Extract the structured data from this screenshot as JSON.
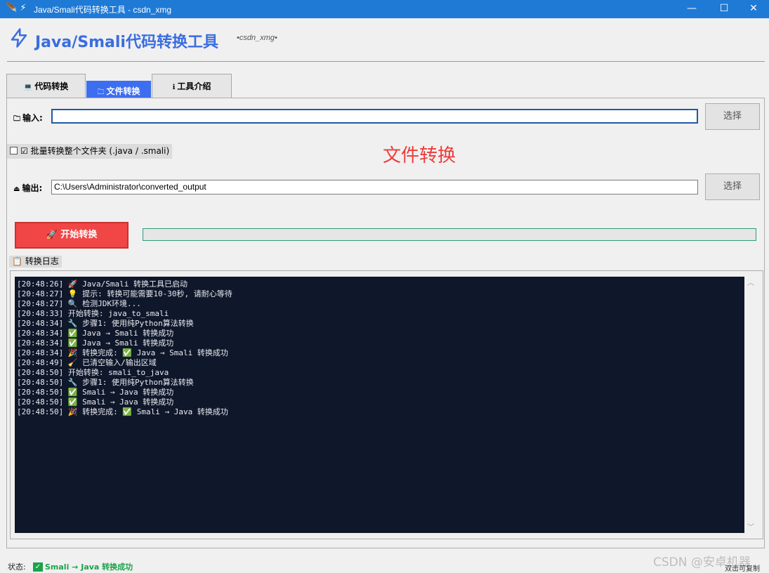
{
  "window": {
    "title": "Java/Smali代码转换工具 - csdn_xmg",
    "controls": {
      "minimize": "—",
      "maximize": "☐",
      "close": "✕"
    }
  },
  "header": {
    "title": "Java/Smali代码转换工具",
    "subtitle": "•csdn_xmg•",
    "accent_color": "#3a6de0"
  },
  "tabs": [
    {
      "label": "代码转换",
      "icon": "laptop-icon",
      "glyph": "💻"
    },
    {
      "label": "文件转换",
      "icon": "folder-icon",
      "glyph": "🗀"
    },
    {
      "label": "工具介绍",
      "icon": "info-icon",
      "glyph": "ℹ"
    }
  ],
  "form": {
    "input_label": "输入:",
    "input_value": "",
    "input_select": "选择",
    "batch_label": "☑ 批量转换整个文件夹 (.java / .smali)",
    "batch_checked": false,
    "section_title": "文件转换",
    "output_label": "输出:",
    "output_value": "C:\\Users\\Administrator\\converted_output",
    "output_select": "选择",
    "start_label": "🚀 开始转换",
    "progress": 0
  },
  "log": {
    "label": "转换日志",
    "lines": [
      "[20:48:26] 🚀 Java/Smali 转换工具已启动",
      "[20:48:27] 💡 提示: 转换可能需要10-30秒, 请耐心等待",
      "[20:48:27] 🔍 检测JDK环境...",
      "[20:48:33] 开始转换: java_to_smali",
      "[20:48:34] 🔧 步骤1: 使用纯Python算法转换",
      "[20:48:34] ✅ Java → Smali 转换成功",
      "[20:48:34] ✅ Java → Smali 转换成功",
      "[20:48:34] 🎉 转换完成: ✅ Java → Smali 转换成功",
      "[20:48:49] 🧹 已清空输入/输出区域",
      "[20:48:50] 开始转换: smali_to_java",
      "[20:48:50] 🔧 步骤1: 使用纯Python算法转换",
      "[20:48:50] ✅ Smali → Java 转换成功",
      "[20:48:50] ✅ Smali → Java 转换成功",
      "[20:48:50] 🎉 转换完成: ✅ Smali → Java 转换成功"
    ]
  },
  "status": {
    "label": "状态:",
    "value": "Smali → Java 转换成功",
    "color": "#1aa34a"
  },
  "hint": "双击可复制",
  "watermark": "CSDN @安卓机器"
}
